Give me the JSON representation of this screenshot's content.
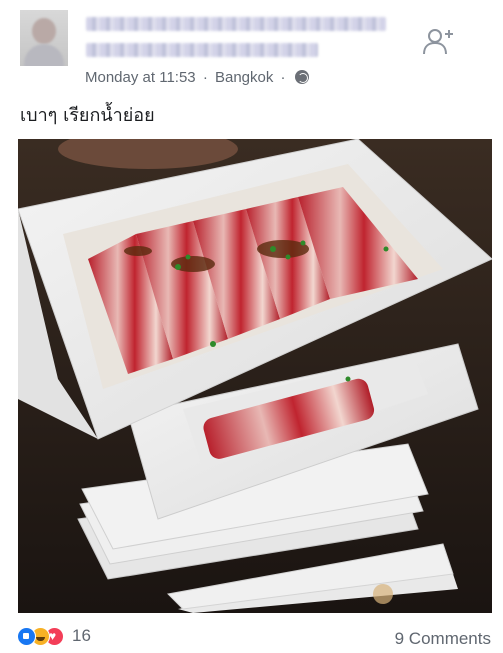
{
  "post": {
    "timestamp": "Monday at 11:53",
    "separator": "·",
    "location": "Bangkok",
    "privacy_icon": "globe-icon",
    "caption": "เบาๆ เรียกน้ำย่อย",
    "author_blurred": true
  },
  "footer": {
    "reaction_icons": [
      "like-icon",
      "haha-icon",
      "love-icon"
    ],
    "reaction_count": "16",
    "comments_label": "9 Comments"
  },
  "colors": {
    "accent": "#1877f2",
    "meta_text": "#606770",
    "like": "#1877f2",
    "haha": "#f7b125",
    "love": "#f33e58"
  }
}
